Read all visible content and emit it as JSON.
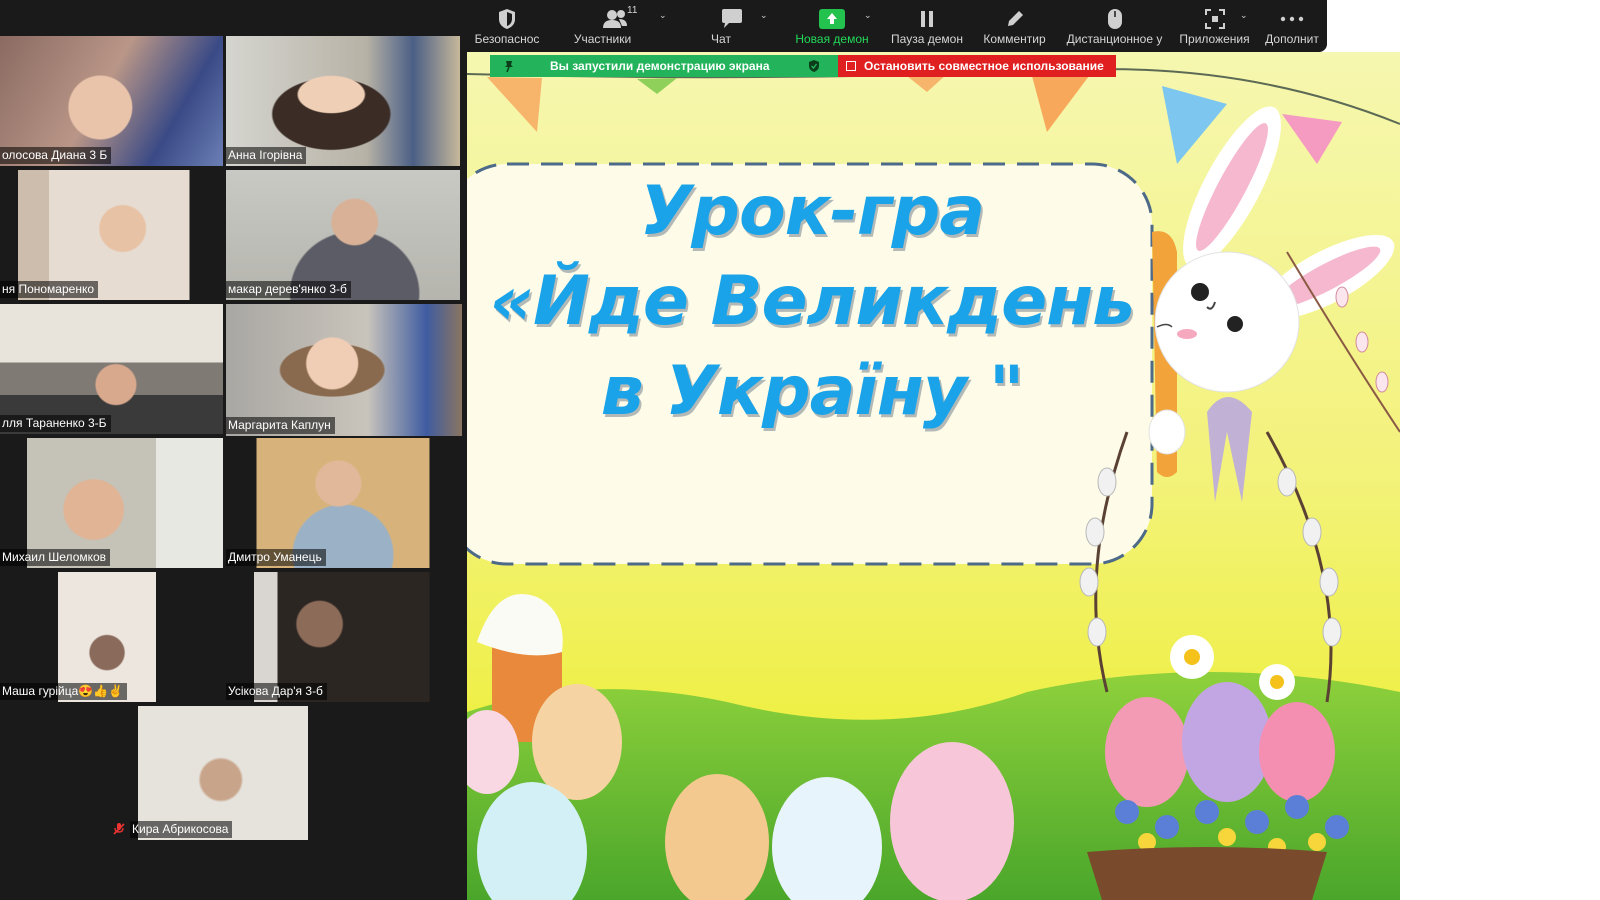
{
  "toolbar": {
    "security": "Безопаснос",
    "participants": "Участники",
    "participants_count": "11",
    "chat": "Чат",
    "new_share": "Новая демон",
    "pause_share": "Пауза демон",
    "annotate": "Комментир",
    "remote_control": "Дистанционное у",
    "apps": "Приложения",
    "more": "Дополнит"
  },
  "share_bar": {
    "status": "Вы запустили демонстрацию экрана",
    "stop": "Остановить совместное использование"
  },
  "participants": [
    {
      "name": "олосова Диана 3 Б"
    },
    {
      "name": "Анна Ігорівна"
    },
    {
      "name": "ня Пономаренко"
    },
    {
      "name": "макар  дерев'янко 3-б"
    },
    {
      "name": "лля Тараненко 3-Б"
    },
    {
      "name": "Маргарита Каплун"
    },
    {
      "name": "Михаил Шеломков"
    },
    {
      "name": "Дмитро Уманець"
    },
    {
      "name": "Маша  гурійца😍👍✌"
    },
    {
      "name": "Усікова Дар'я 3-б"
    },
    {
      "name": "Кира Абрикосова"
    }
  ],
  "slide": {
    "title_line1": "Урок-гра",
    "title_line2": "«Йде Великдень",
    "title_line3": "в Україну \""
  },
  "colors": {
    "share_green": "#23b35a",
    "stop_red": "#e02020",
    "title_blue": "#1aa3e8",
    "active_speaker": "#e7e36a"
  }
}
